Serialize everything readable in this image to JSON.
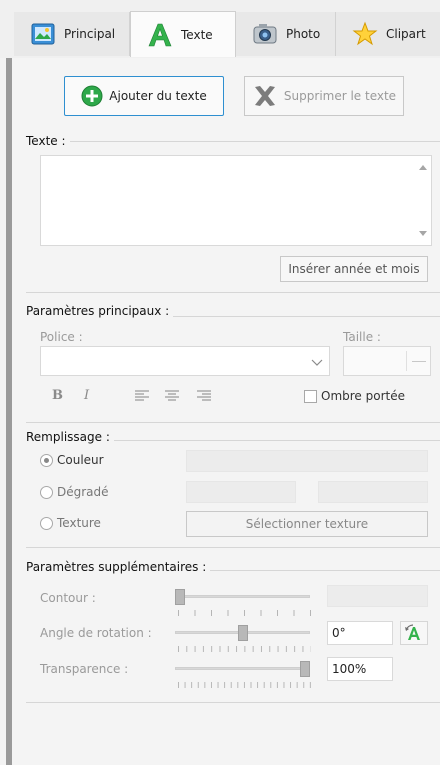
{
  "tabs": [
    {
      "label": "Principal",
      "icon": "picture-frame-icon"
    },
    {
      "label": "Texte",
      "icon": "letter-a-icon",
      "active": true
    },
    {
      "label": "Photo",
      "icon": "camera-icon"
    },
    {
      "label": "Clipart",
      "icon": "star-icon"
    }
  ],
  "actions": {
    "add_text": "Ajouter du texte",
    "delete_text": "Supprimer le texte"
  },
  "text_group": {
    "title": "Texte :",
    "value": "",
    "insert_date_button": "Insérer année et mois"
  },
  "main_params": {
    "title": "Paramètres principaux :",
    "font_label": "Police :",
    "font_value": "",
    "size_label": "Taille :",
    "size_value": "",
    "bold": "B",
    "italic": "I",
    "shadow_label": "Ombre portée",
    "shadow_checked": false
  },
  "fill": {
    "title": "Remplissage :",
    "options": [
      "Couleur",
      "Dégradé",
      "Texture"
    ],
    "selected": "Couleur",
    "texture_button": "Sélectionner texture"
  },
  "extra_params": {
    "title": "Paramètres supplémentaires :",
    "contour_label": "Contour :",
    "contour_level": 0,
    "rotation_label": "Angle de rotation :",
    "rotation_value": "0°",
    "rotation_level": 0.5,
    "transparency_label": "Transparence :",
    "transparency_value": "100%",
    "transparency_level": 1.0
  },
  "colors": {
    "accent": "#2e8fd0",
    "add_icon_green": "#2ea84a",
    "leftbar": "#9a9a9a"
  }
}
